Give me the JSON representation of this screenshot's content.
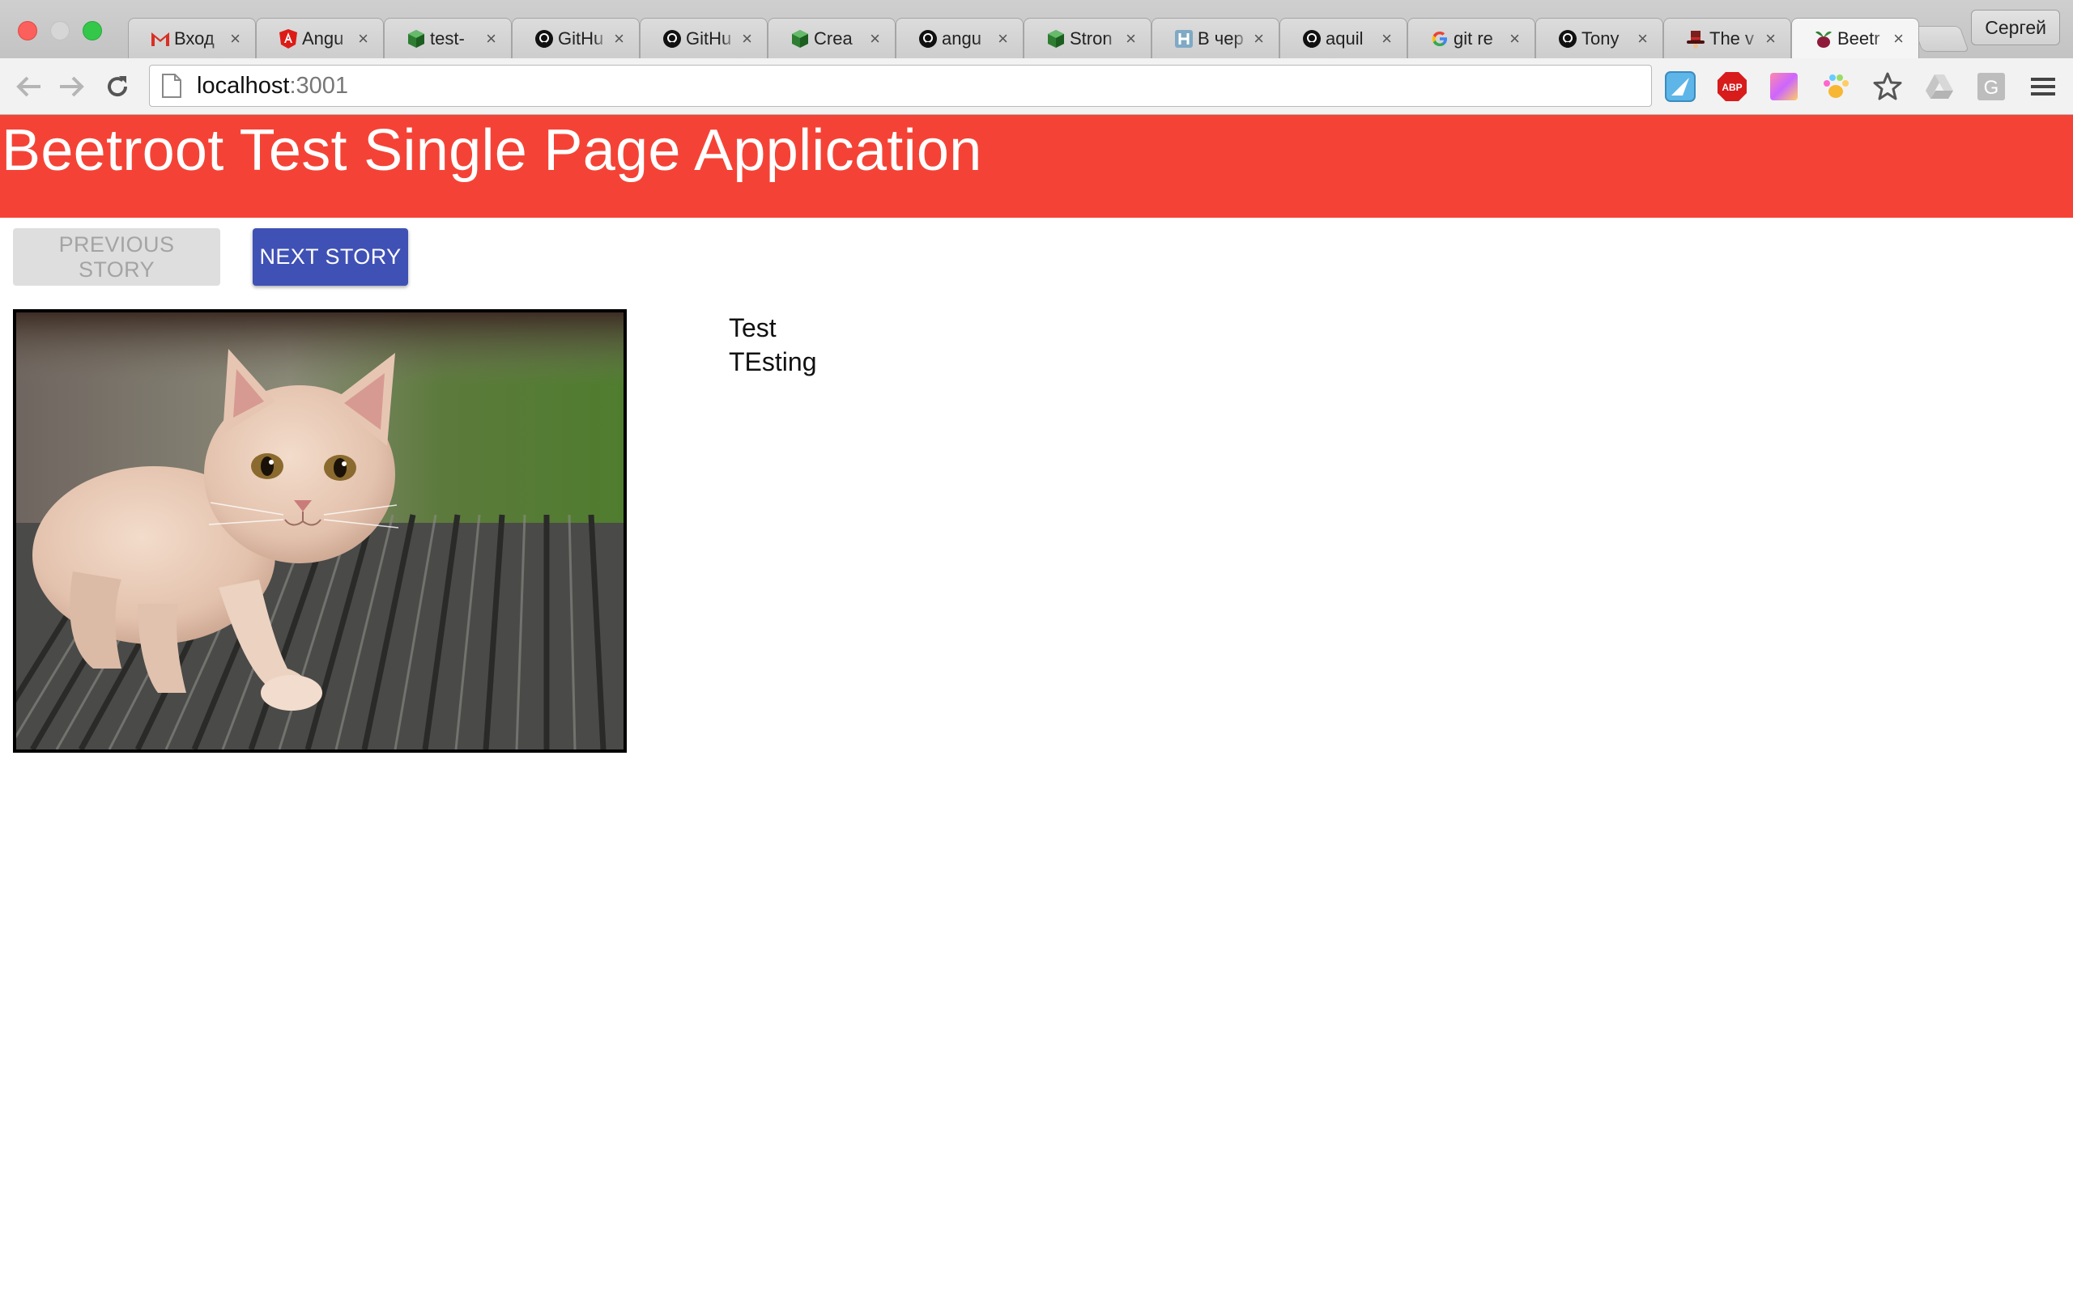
{
  "browser": {
    "tabs": [
      {
        "title": "Вход",
        "icon": "gmail-icon",
        "active": false
      },
      {
        "title": "Angu",
        "icon": "angular-icon",
        "active": false
      },
      {
        "title": "test-",
        "icon": "cube-icon",
        "active": false
      },
      {
        "title": "GitHu",
        "icon": "github-icon",
        "active": false
      },
      {
        "title": "GitHu",
        "icon": "github-icon",
        "active": false
      },
      {
        "title": "Crea",
        "icon": "cube-icon",
        "active": false
      },
      {
        "title": "angu",
        "icon": "github-icon",
        "active": false
      },
      {
        "title": "Stron",
        "icon": "cube-icon",
        "active": false
      },
      {
        "title": "В чер",
        "icon": "habr-icon",
        "active": false
      },
      {
        "title": "aquil",
        "icon": "github-icon",
        "active": false
      },
      {
        "title": "git re",
        "icon": "google-icon",
        "active": false
      },
      {
        "title": "Tony",
        "icon": "github-icon",
        "active": false
      },
      {
        "title": "The v",
        "icon": "hat-icon",
        "active": false
      },
      {
        "title": "Beetr",
        "icon": "beetroot-icon",
        "active": true
      }
    ],
    "tab_close_glyph": "×",
    "profile_name": "Сергей",
    "url": {
      "host": "localhost",
      "port": ":3001"
    }
  },
  "app": {
    "title": "Beetroot Test Single Page Application",
    "header_color": "#f44336",
    "previous_label": "PREVIOUS STORY",
    "next_label": "NEXT STORY",
    "next_color": "#3f51b5",
    "story": {
      "image": "kitten-photo",
      "lines": [
        "Test",
        "TEsting"
      ]
    }
  }
}
